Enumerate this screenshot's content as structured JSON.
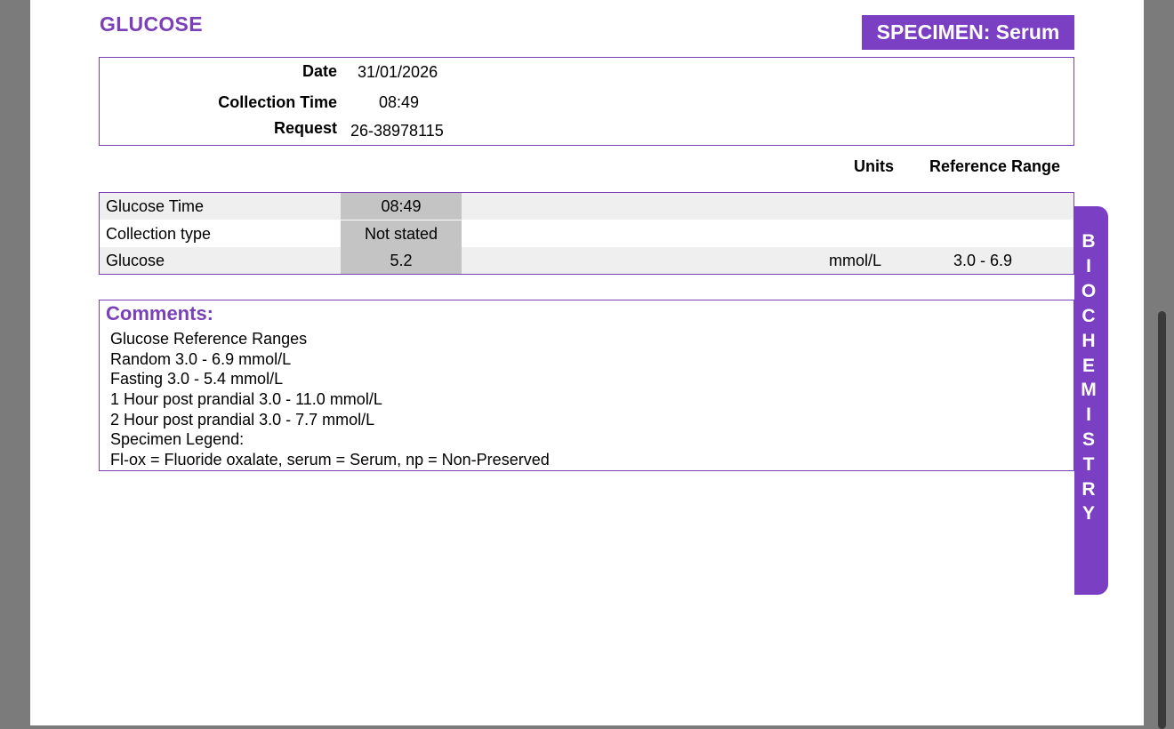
{
  "header": {
    "title": "GLUCOSE",
    "specimen": "SPECIMEN: Serum"
  },
  "info": {
    "date_label": "Date",
    "date_value": "31/01/2026",
    "collection_time_label": "Collection Time",
    "collection_time_value": "08:49",
    "request_label": "Request",
    "request_value": "26-38978115"
  },
  "columns": {
    "units": "Units",
    "reference_range": "Reference Range"
  },
  "results": [
    {
      "name": "Glucose Time",
      "value": "08:49",
      "units": "",
      "ref": ""
    },
    {
      "name": "Collection type",
      "value": "Not stated",
      "units": "",
      "ref": ""
    },
    {
      "name": "Glucose",
      "value": "5.2",
      "units": "mmol/L",
      "ref": "3.0 - 6.9"
    }
  ],
  "comments": {
    "title": "Comments:",
    "lines": [
      "Glucose Reference Ranges",
      "Random 3.0 - 6.9 mmol/L",
      "Fasting 3.0 - 5.4 mmol/L",
      "1 Hour post prandial 3.0 - 11.0 mmol/L",
      "2 Hour post prandial 3.0 - 7.7 mmol/L",
      "Specimen Legend:",
      "Fl-ox = Fluoride oxalate, serum = Serum, np = Non-Preserved"
    ]
  },
  "side_tab": {
    "letters": [
      "B",
      "I",
      "O",
      "C",
      "H",
      "E",
      "M",
      "I",
      "S",
      "T",
      "R",
      "Y"
    ]
  },
  "colors": {
    "accent": "#7b3fc4",
    "row_shade": "#efefef",
    "value_cell": "#c4c4c4"
  }
}
